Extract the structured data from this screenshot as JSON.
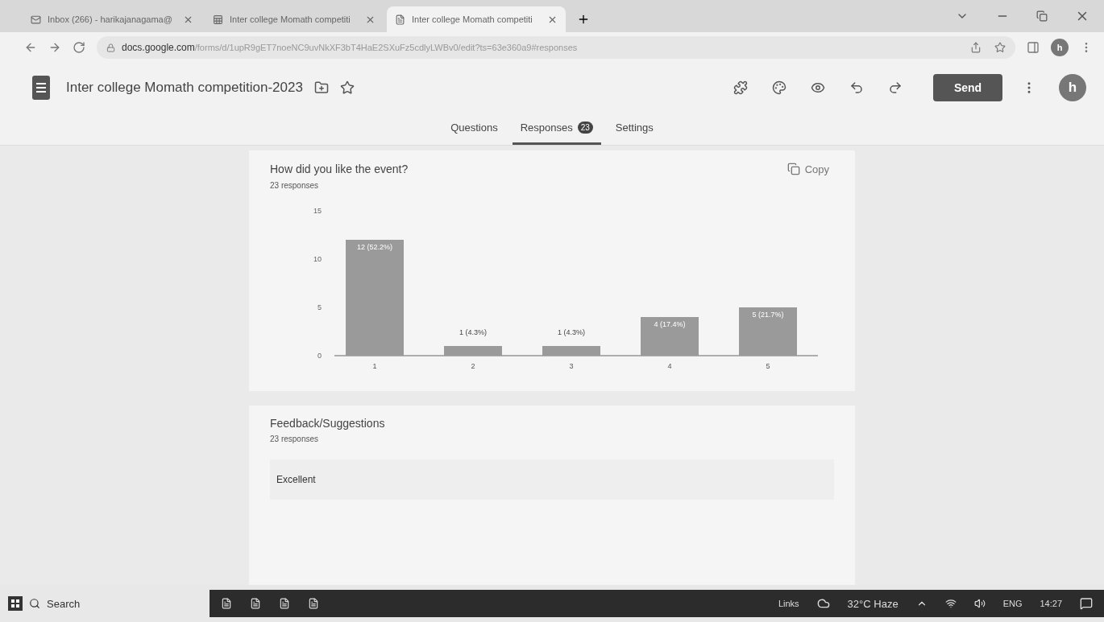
{
  "browser_tabs": [
    {
      "label": "Inbox (266) - harikajanagama@",
      "selected": false,
      "kind": "mail"
    },
    {
      "label": "Inter college Momath competiti",
      "selected": false,
      "kind": "sheet"
    },
    {
      "label": "Inter college Momath competiti",
      "selected": true,
      "kind": "form"
    }
  ],
  "address_bar": {
    "host": "docs.google.com",
    "path": "/forms/d/1upR9gET7noeNC9uvNkXF3bT4HaE2SXuFz5cdlyLWBv0/edit?ts=63e360a9#responses"
  },
  "profile_initial": "h",
  "form": {
    "title": "Inter college Momath competition-2023",
    "send_label": "Send",
    "avatar_initial": "h"
  },
  "form_tabs": [
    {
      "label": "Questions",
      "selected": false
    },
    {
      "label": "Responses",
      "badge": "23",
      "selected": true
    },
    {
      "label": "Settings",
      "selected": false
    }
  ],
  "questions": [
    {
      "kind": "chart",
      "title": "How did you like the event?",
      "count": "23 responses",
      "copy_label": "Copy",
      "chart_data": {
        "type": "bar",
        "categories": [
          "1",
          "2",
          "3",
          "4",
          "5"
        ],
        "values": [
          12,
          1,
          1,
          4,
          5
        ],
        "ylim": [
          0,
          15
        ],
        "yticks": [
          0,
          5,
          10,
          15
        ],
        "value_labels": [
          "12 (52.2%)",
          "1 (4.3%)",
          "1 (4.3%)",
          "4 (17.4%)",
          "5 (21.7%)"
        ]
      }
    },
    {
      "kind": "text",
      "title": "Feedback/Suggestions",
      "count": "23 responses",
      "answers": [
        "Excellent"
      ]
    }
  ],
  "taskbar": {
    "search": "Search",
    "links": "Links",
    "weather": "32°C  Haze",
    "language": "ENG",
    "time": "14:27"
  }
}
